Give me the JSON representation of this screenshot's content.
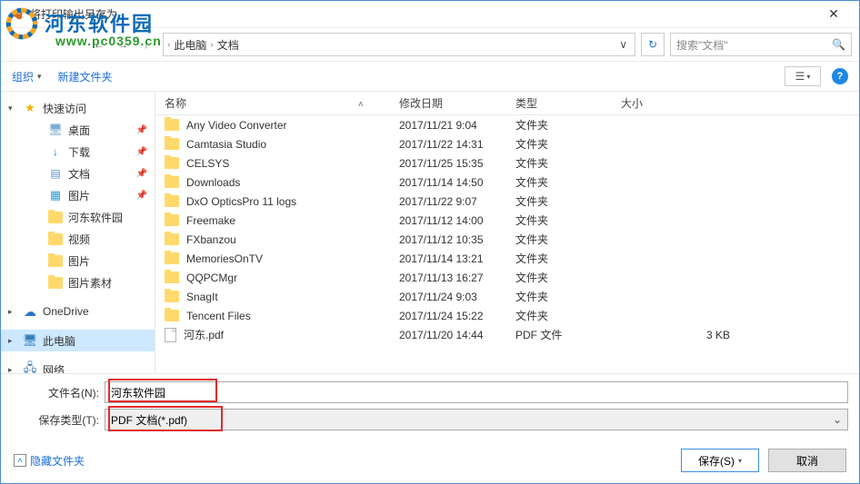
{
  "window": {
    "title": "将打印输出另存为",
    "close": "✕"
  },
  "watermark": {
    "text": "河东软件园",
    "url": "www.pc0359.cn"
  },
  "nav": {
    "breadcrumb": [
      "此电脑",
      "文档"
    ],
    "refresh_icon": "↻",
    "search_placeholder": "搜索\"文档\""
  },
  "toolbar": {
    "organize": "组织",
    "new_folder": "新建文件夹"
  },
  "sidebar": {
    "quick_access": "快速访问",
    "items": [
      {
        "icon": "desk",
        "label": "桌面",
        "pinned": true
      },
      {
        "icon": "dl",
        "label": "下载",
        "pinned": true
      },
      {
        "icon": "doc",
        "label": "文档",
        "pinned": true
      },
      {
        "icon": "pic",
        "label": "图片",
        "pinned": true
      },
      {
        "icon": "folder",
        "label": "河东软件园",
        "pinned": false
      },
      {
        "icon": "folder",
        "label": "视频",
        "pinned": false
      },
      {
        "icon": "folder",
        "label": "图片",
        "pinned": false
      },
      {
        "icon": "folder",
        "label": "图片素材",
        "pinned": false
      }
    ],
    "onedrive": "OneDrive",
    "this_pc": "此电脑",
    "network": "网络"
  },
  "columns": {
    "name": "名称",
    "date": "修改日期",
    "type": "类型",
    "size": "大小"
  },
  "type_labels": {
    "folder": "文件夹",
    "pdf": "PDF 文件"
  },
  "files": [
    {
      "name": "Any Video Converter",
      "date": "2017/11/21 9:04",
      "type": "folder",
      "size": ""
    },
    {
      "name": "Camtasia Studio",
      "date": "2017/11/22 14:31",
      "type": "folder",
      "size": ""
    },
    {
      "name": "CELSYS",
      "date": "2017/11/25 15:35",
      "type": "folder",
      "size": ""
    },
    {
      "name": "Downloads",
      "date": "2017/11/14 14:50",
      "type": "folder",
      "size": ""
    },
    {
      "name": "DxO OpticsPro 11 logs",
      "date": "2017/11/22 9:07",
      "type": "folder",
      "size": ""
    },
    {
      "name": "Freemake",
      "date": "2017/11/12 14:00",
      "type": "folder",
      "size": ""
    },
    {
      "name": "FXbanzou",
      "date": "2017/11/12 10:35",
      "type": "folder",
      "size": ""
    },
    {
      "name": "MemoriesOnTV",
      "date": "2017/11/14 13:21",
      "type": "folder",
      "size": ""
    },
    {
      "name": "QQPCMgr",
      "date": "2017/11/13 16:27",
      "type": "folder",
      "size": ""
    },
    {
      "name": "SnagIt",
      "date": "2017/11/24 9:03",
      "type": "folder",
      "size": ""
    },
    {
      "name": "Tencent Files",
      "date": "2017/11/24 15:22",
      "type": "folder",
      "size": ""
    },
    {
      "name": "河东.pdf",
      "date": "2017/11/20 14:44",
      "type": "pdf",
      "size": "3 KB"
    }
  ],
  "form": {
    "filename_label": "文件名(N):",
    "filename_value": "河东软件园",
    "filetype_label": "保存类型(T):",
    "filetype_value": "PDF 文档(*.pdf)"
  },
  "footer": {
    "hide_folders": "隐藏文件夹",
    "save": "保存(S)",
    "cancel": "取消"
  }
}
